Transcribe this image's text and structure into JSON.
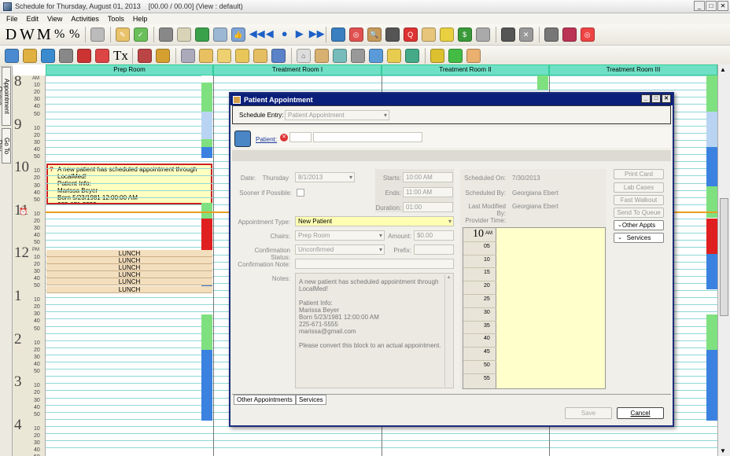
{
  "window": {
    "title": "Schedule for Thursday, August 01, 2013",
    "status": "[00.00 / 00.00] (View : default)"
  },
  "menu": [
    "File",
    "Edit",
    "View",
    "Activities",
    "Tools",
    "Help"
  ],
  "toolbar": {
    "view_labels": [
      "D",
      "W",
      "M"
    ],
    "rx_label": "Tx"
  },
  "side_tabs": [
    "Appointment Queue",
    "Go To Day"
  ],
  "columns": [
    "Prep Room",
    "Treatment Room I",
    "Treatment Room II",
    "Treatment Room III"
  ],
  "hours": [
    {
      "h": "8",
      "ap": "AM"
    },
    {
      "h": "9",
      "ap": ""
    },
    {
      "h": "10",
      "ap": ""
    },
    {
      "h": "11",
      "ap": ""
    },
    {
      "h": "12",
      "ap": "PM"
    },
    {
      "h": "1",
      "ap": ""
    },
    {
      "h": "2",
      "ap": ""
    },
    {
      "h": "3",
      "ap": ""
    },
    {
      "h": "4",
      "ap": ""
    }
  ],
  "minute_labels": [
    "10",
    "20",
    "30",
    "40",
    "50"
  ],
  "lunch_label": "LUNCH",
  "block_note": [
    "A new patient has scheduled appointment through",
    "LocalMed!",
    "Patient Info:",
    "Marissa Beyer",
    "Born 5/23/1981 12:00:00 AM",
    "225-671-5555"
  ],
  "dialog": {
    "title": "Patient Appointment",
    "schedule_entry_label": "Schedule Entry:",
    "schedule_entry_value": "Patient Appointment",
    "patient_label": "Patient:",
    "date_label": "Date:",
    "day": "Thursday",
    "date": "8/1/2013",
    "starts_label": "Starts:",
    "starts": "10:00 AM",
    "ends_label": "Ends:",
    "ends": "11:00 AM",
    "duration_label": "Duration:",
    "duration": "01:00",
    "sooner_label": "Sooner if Possible:",
    "appt_type_label": "Appointment Type:",
    "appt_type": "New Patient",
    "chairs_label": "Chairs:",
    "chairs": "Prep Room",
    "amount_label": "Amount:",
    "amount": "$0.00",
    "confirm_status_label": "Confirmation Status:",
    "confirm_status": "Unconfirmed",
    "prefix_label": "Prefix:",
    "confirm_note_label": "Confirmation Note:",
    "notes_label": "Notes:",
    "notes": [
      "A new patient has scheduled appointment through",
      "LocalMed!",
      "",
      "Patient Info:",
      "Marissa Beyer",
      "Born 5/23/1981 12:00:00 AM",
      "225-671-5555",
      "marissa@gmail.com",
      "",
      "Please convert this block to an actual appointment."
    ],
    "scheduled_on_label": "Scheduled On:",
    "scheduled_on": "7/30/2013",
    "scheduled_by_label": "Scheduled By:",
    "scheduled_by": "Georgiana Ebert",
    "modified_by_label": "Last Modified By:",
    "modified_by": "Georgiana Ebert",
    "provider_time_label": "Provider Time:",
    "pt_hour": "10",
    "pt_ampm": "AM",
    "pt_minutes": [
      "05",
      "10",
      "15",
      "20",
      "25",
      "30",
      "35",
      "40",
      "45",
      "50",
      "55"
    ],
    "buttons": [
      "Print Card",
      "Lab Cases",
      "Fast Walkout",
      "Send To Queue",
      "Other Appts",
      "Services"
    ],
    "tabs": [
      "Other Appointments",
      "Services"
    ],
    "save": "Save",
    "cancel": "Cancel"
  },
  "colors": {
    "accent": "#0a1f7a",
    "header": "#6fe0c6",
    "note": "#ffffc0",
    "lunch": "#f3debd"
  }
}
